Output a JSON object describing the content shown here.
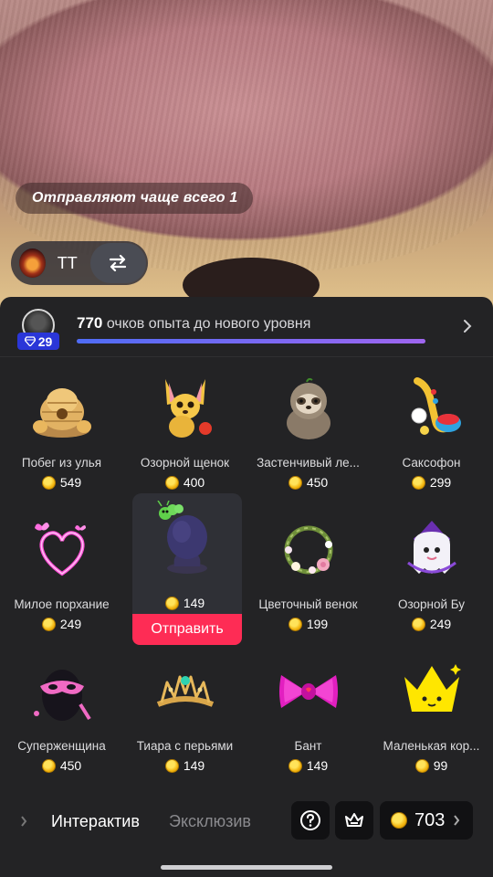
{
  "stream": {
    "top_pill_text": "Отправляют чаще всего 1",
    "user_name": "TT"
  },
  "level": {
    "points": "770",
    "points_suffix": " очков опыта до нового уровня",
    "badge": "29",
    "progress": 1.0
  },
  "gifts": [
    {
      "name": "Побег из улья",
      "price": "549",
      "icon": "beehive-icon"
    },
    {
      "name": "Озорной щенок",
      "price": "400",
      "icon": "puppy-icon"
    },
    {
      "name": "Застенчивый ле...",
      "price": "450",
      "icon": "sloth-icon"
    },
    {
      "name": "Саксофон",
      "price": "299",
      "icon": "saxophone-icon"
    },
    {
      "name": "Милое порхание",
      "price": "249",
      "icon": "butterfly-heart-icon"
    },
    {
      "name": "",
      "price": "149",
      "icon": "head-with-caterpillar-icon",
      "selected": true
    },
    {
      "name": "Цветочный венок",
      "price": "199",
      "icon": "flower-wreath-icon"
    },
    {
      "name": "Озорной Бу",
      "price": "249",
      "icon": "ghost-icon"
    },
    {
      "name": "Суперженщина",
      "price": "450",
      "icon": "mask-icon"
    },
    {
      "name": "Тиара с перьями",
      "price": "149",
      "icon": "tiara-icon"
    },
    {
      "name": "Бант",
      "price": "149",
      "icon": "bow-icon"
    },
    {
      "name": "Маленькая кор...",
      "price": "99",
      "icon": "crown-icon"
    }
  ],
  "send_label": "Отправить",
  "tabs": {
    "active": "Интерактив",
    "inactive": "Эксклюзив"
  },
  "coins": "703",
  "colors": {
    "accent": "#fe2c55",
    "panel": "#232325",
    "level_badge": "#2a36d8",
    "coin": "#f2b40e"
  }
}
